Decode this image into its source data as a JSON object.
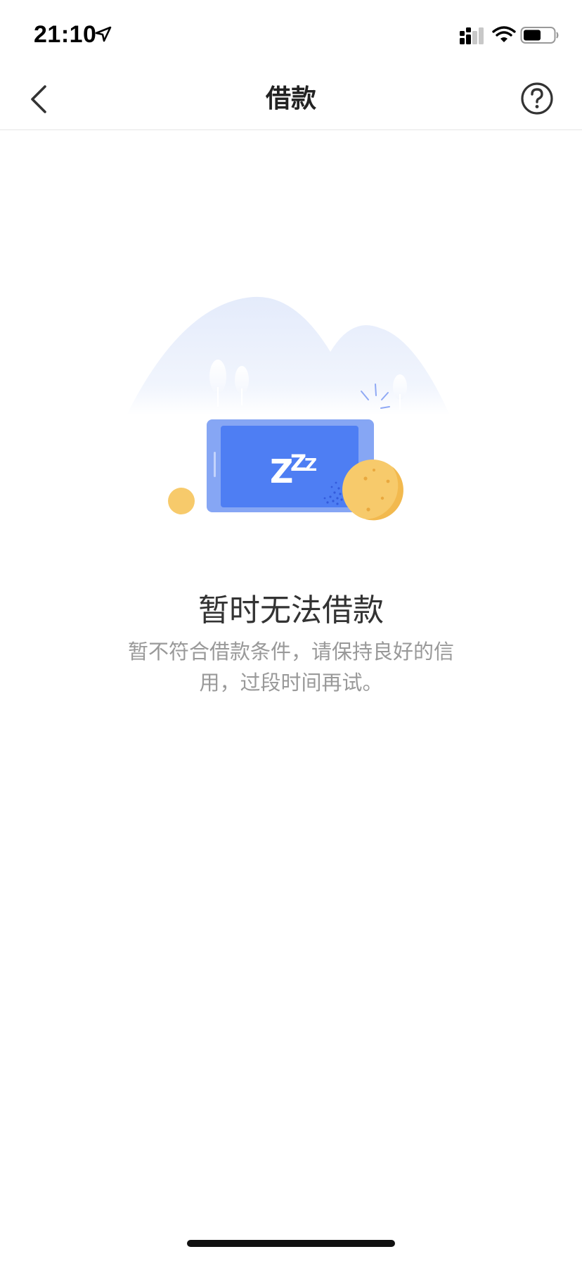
{
  "status_bar": {
    "time": "21:10"
  },
  "nav": {
    "title": "借款"
  },
  "illustration": {
    "sleep_text": "ZZZ"
  },
  "message": {
    "title": "暂时无法借款",
    "description": "暂不符合借款条件，请保持良好的信用，过段时间再试。"
  },
  "colors": {
    "accent_blue": "#4e7ef3",
    "coin_yellow": "#f7ca6b",
    "title_text": "#333333",
    "desc_text": "#999999"
  }
}
